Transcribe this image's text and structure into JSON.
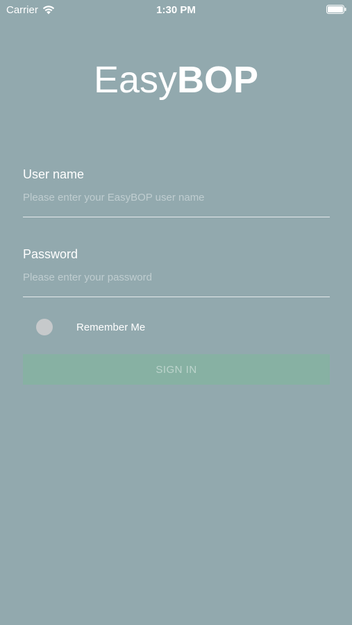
{
  "status_bar": {
    "carrier": "Carrier",
    "time": "1:30 PM",
    "wifi_icon": "wifi-icon",
    "battery_icon": "battery-icon"
  },
  "logo": {
    "light_part": "Easy",
    "bold_part": "BOP"
  },
  "username": {
    "label": "User name",
    "placeholder": "Please enter your EasyBOP user name",
    "value": ""
  },
  "password": {
    "label": "Password",
    "placeholder": "Please enter your password",
    "value": ""
  },
  "remember_me": {
    "label": "Remember Me",
    "checked": false
  },
  "sign_in": {
    "label": "SIGN IN",
    "enabled": false
  },
  "colors": {
    "background": "#92a9ae",
    "button": "#87b1a3",
    "toggle": "#c6c9cb",
    "text": "#ffffff"
  }
}
